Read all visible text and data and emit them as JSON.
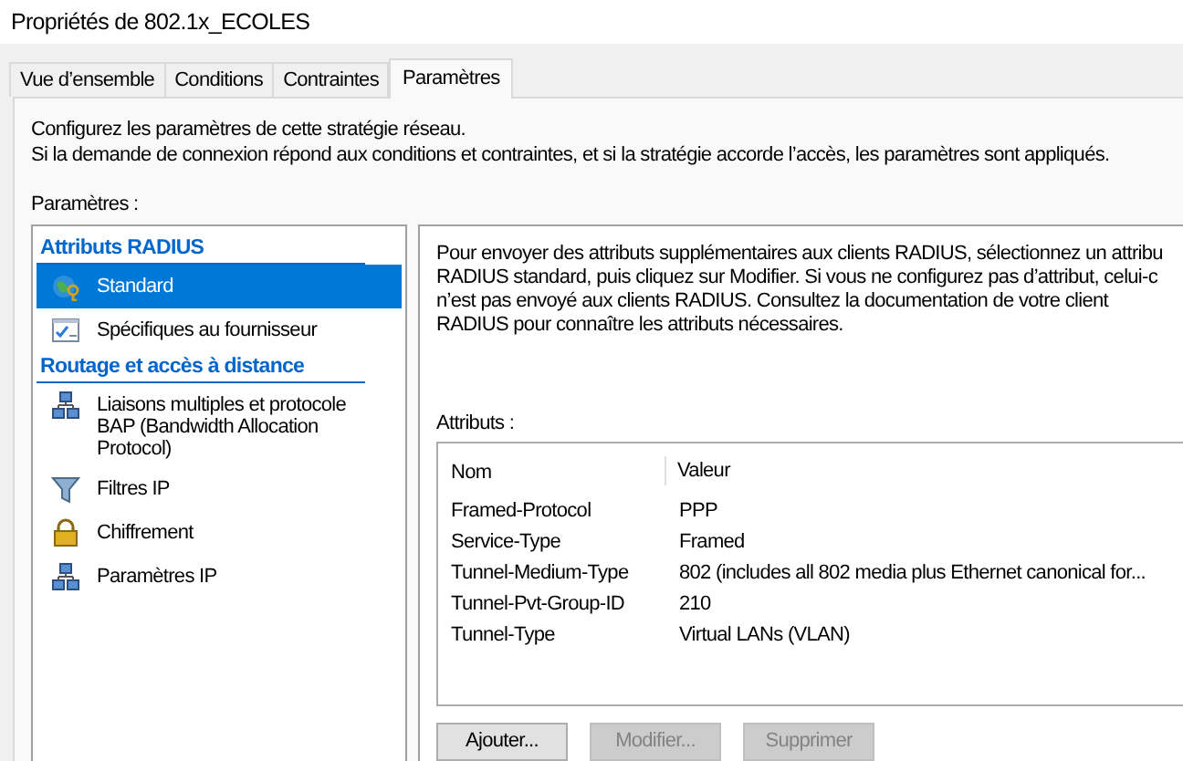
{
  "window": {
    "title": "Propriétés de 802.1x_ECOLES"
  },
  "tabs": [
    {
      "label": "Vue d’ensemble",
      "selected": false
    },
    {
      "label": "Conditions",
      "selected": false
    },
    {
      "label": "Contraintes",
      "selected": false
    },
    {
      "label": "Paramètres",
      "selected": true
    }
  ],
  "intro": [
    "Configurez les paramètres de cette stratégie réseau.",
    "Si la demande de connexion répond aux conditions et contraintes, et si la stratégie accorde l’accès, les paramètres sont appliqués."
  ],
  "settings_label": "Paramètres :",
  "sidebar": {
    "groups": [
      {
        "heading": "Attributs RADIUS",
        "items": [
          {
            "label": "Standard",
            "selected": true
          },
          {
            "label": "Spécifiques au fournisseur",
            "selected": false
          }
        ]
      },
      {
        "heading": "Routage et accès à distance",
        "items": [
          {
            "label": "Liaisons multiples et protocole BAP (Bandwidth Allocation Protocol)",
            "selected": false
          },
          {
            "label": "Filtres IP",
            "selected": false
          },
          {
            "label": "Chiffrement",
            "selected": false
          },
          {
            "label": "Paramètres IP",
            "selected": false
          }
        ]
      }
    ]
  },
  "description": [
    "Pour envoyer des attributs supplémentaires aux clients RADIUS, sélectionnez un attribu",
    "RADIUS standard, puis cliquez sur Modifier. Si vous ne configurez pas d’attribut, celui-c",
    "n’est pas envoyé aux clients RADIUS. Consultez la documentation de votre client",
    "RADIUS pour connaître les attributs nécessaires."
  ],
  "attributes_label": "Attributs :",
  "table": {
    "columns": [
      "Nom",
      "Valeur"
    ],
    "rows": [
      [
        "Framed-Protocol",
        "PPP"
      ],
      [
        "Service-Type",
        "Framed"
      ],
      [
        "Tunnel-Medium-Type",
        "802 (includes all 802 media plus Ethernet canonical for..."
      ],
      [
        "Tunnel-Pvt-Group-ID",
        "210"
      ],
      [
        "Tunnel-Type",
        "Virtual LANs (VLAN)"
      ]
    ]
  },
  "buttons": [
    {
      "label": "Ajouter...",
      "disabled": false
    },
    {
      "label": "Modifier...",
      "disabled": true
    },
    {
      "label": "Supprimer",
      "disabled": true
    }
  ]
}
